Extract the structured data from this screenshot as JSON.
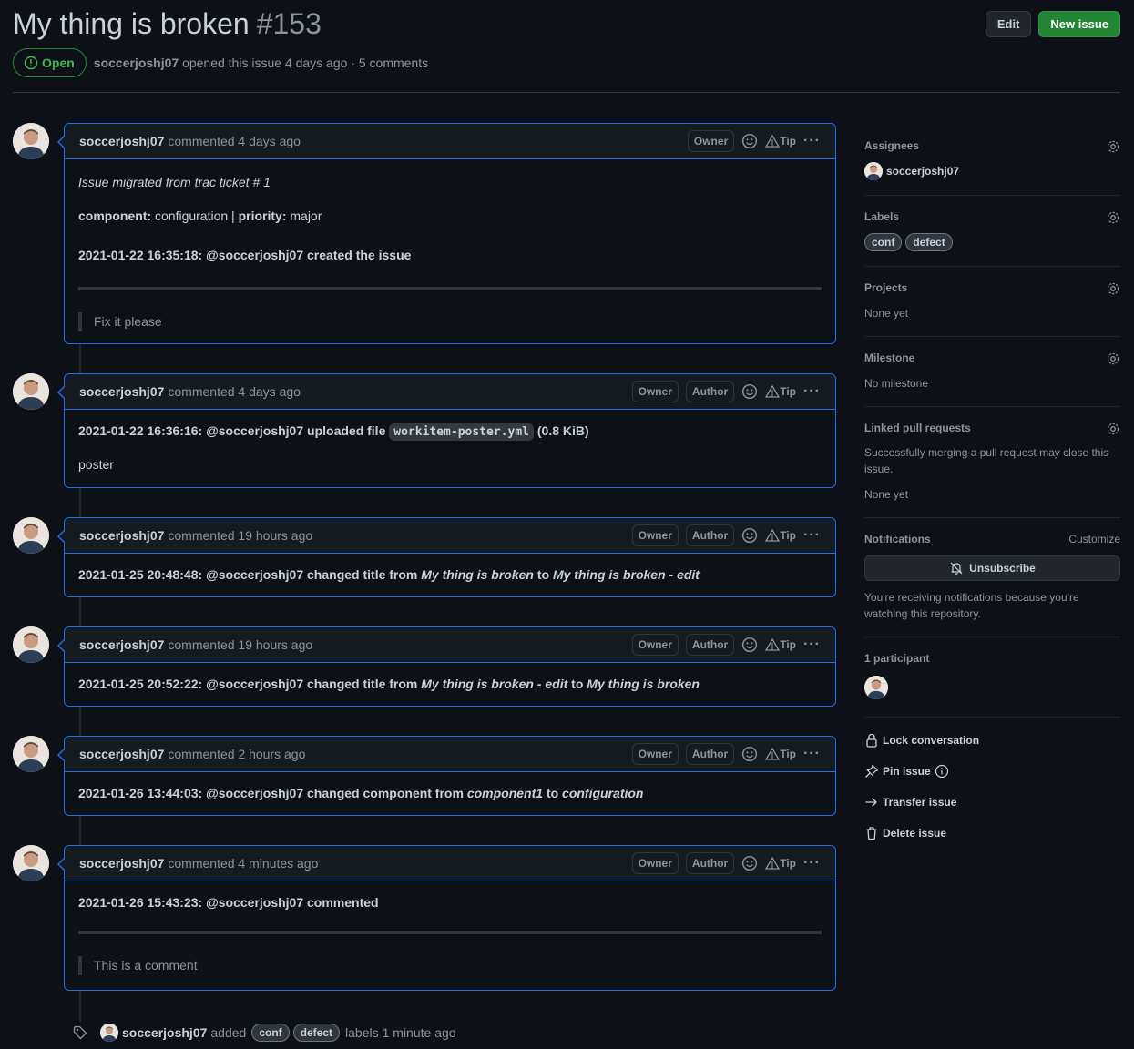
{
  "issue": {
    "title": "My thing is broken",
    "number": "#153",
    "state": "Open",
    "author": "soccerjoshj07",
    "meta": "opened this issue 4 days ago · 5 comments"
  },
  "actions": {
    "edit_label": "Edit",
    "new_issue_label": "New issue"
  },
  "comment_labels": {
    "owner": "Owner",
    "author": "Author",
    "tip": "Tip"
  },
  "comments": [
    {
      "author": "soccerjoshj07",
      "when": "commented 4 days ago",
      "migrated": "Issue migrated from trac ticket # 1",
      "component_key": "component:",
      "component_val": "configuration |",
      "priority_key": "priority:",
      "priority_val": "major",
      "event": "2021-01-22 16:35:18: @soccerjoshj07 created the issue",
      "quote": "Fix it please"
    },
    {
      "author": "soccerjoshj07",
      "when": "commented 4 days ago",
      "event_pre": "2021-01-22 16:36:16: @soccerjoshj07 uploaded file",
      "file": "workitem-poster.yml",
      "event_post": "(0.8 KiB)",
      "text": "poster"
    },
    {
      "author": "soccerjoshj07",
      "when": "commented 19 hours ago",
      "event_pre": "2021-01-25 20:48:48: @soccerjoshj07 changed title from",
      "from": "My thing is broken",
      "to_word": "to",
      "to": "My thing is broken - edit"
    },
    {
      "author": "soccerjoshj07",
      "when": "commented 19 hours ago",
      "event_pre": "2021-01-25 20:52:22: @soccerjoshj07 changed title from",
      "from": "My thing is broken - edit",
      "to_word": "to",
      "to": "My thing is broken"
    },
    {
      "author": "soccerjoshj07",
      "when": "commented 2 hours ago",
      "event_pre": "2021-01-26 13:44:03: @soccerjoshj07 changed component from",
      "from": "component1",
      "to_word": "to",
      "to": "configuration"
    },
    {
      "author": "soccerjoshj07",
      "when": "commented 4 minutes ago",
      "event": "2021-01-26 15:43:23: @soccerjoshj07 commented",
      "quote": "This is a comment"
    }
  ],
  "label_event": {
    "author": "soccerjoshj07",
    "verb": "added",
    "labels": [
      "conf",
      "defect"
    ],
    "suffix": "labels",
    "when": "1 minute ago"
  },
  "sidebar": {
    "assignees": {
      "title": "Assignees",
      "user": "soccerjoshj07"
    },
    "labels": {
      "title": "Labels",
      "items": [
        "conf",
        "defect"
      ]
    },
    "projects": {
      "title": "Projects",
      "value": "None yet"
    },
    "milestone": {
      "title": "Milestone",
      "value": "No milestone"
    },
    "linked_prs": {
      "title": "Linked pull requests",
      "desc": "Successfully merging a pull request may close this issue.",
      "value": "None yet"
    },
    "notifications": {
      "title": "Notifications",
      "customize": "Customize",
      "button": "Unsubscribe",
      "desc": "You're receiving notifications because you're watching this repository."
    },
    "participants": {
      "title": "1 participant"
    },
    "actions": {
      "lock": "Lock conversation",
      "pin": "Pin issue",
      "transfer": "Transfer issue",
      "delete": "Delete issue"
    }
  },
  "colors": {
    "background": "#0d1117",
    "accent_blue": "#1f6feb",
    "open_green": "#3fb950",
    "new_issue_green": "#238636",
    "muted": "#8b949e"
  },
  "icons": [
    "issue-opened-icon",
    "smiley-icon",
    "triangle-icon",
    "kebab-icon",
    "gear-icon",
    "bell-slash-icon",
    "lock-icon",
    "pin-icon",
    "info-icon",
    "arrow-right-icon",
    "trash-icon",
    "tag-icon"
  ]
}
